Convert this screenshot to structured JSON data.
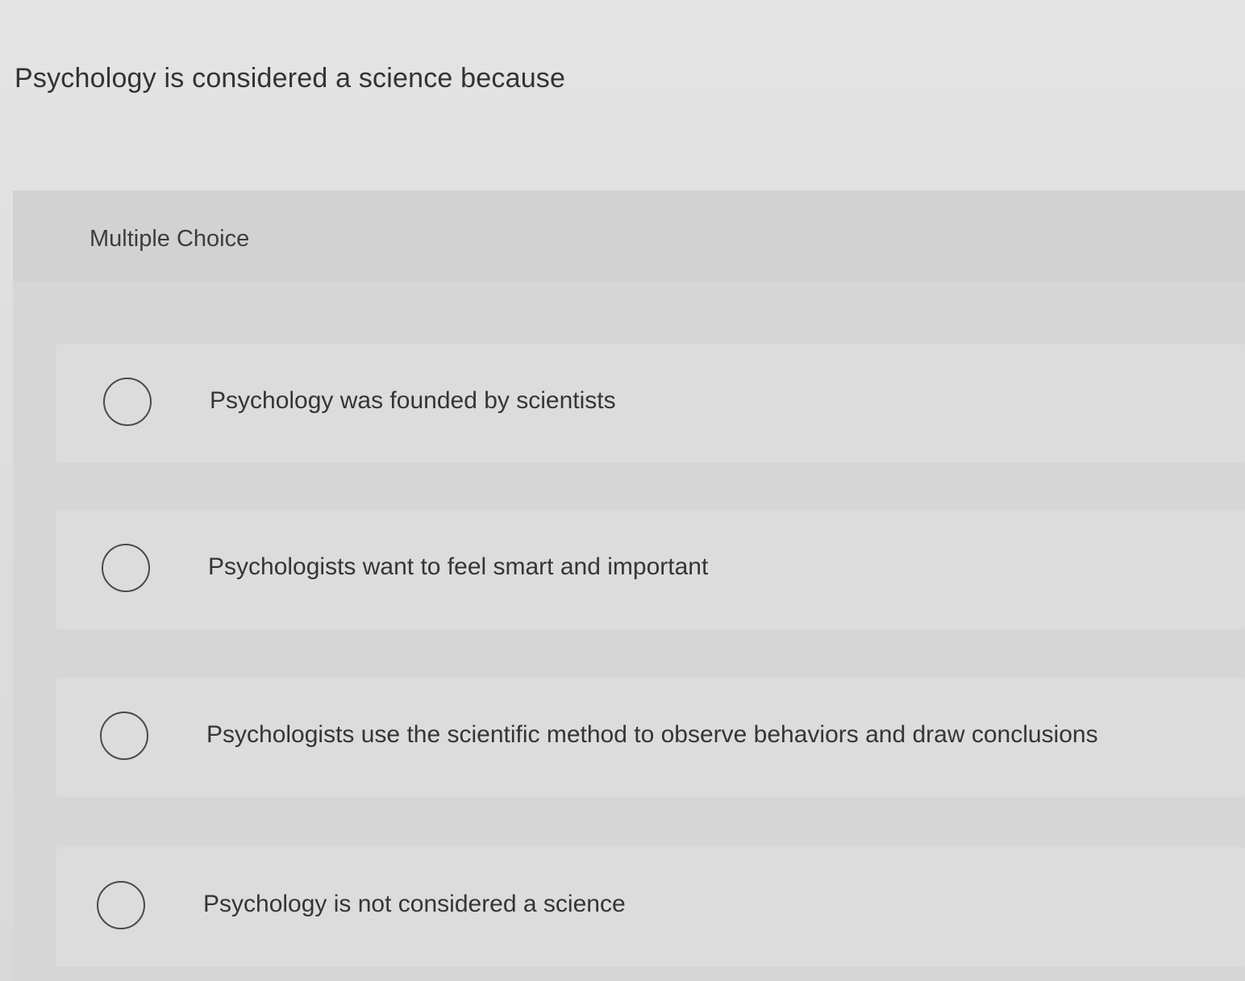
{
  "question": {
    "text": "Psychology is considered a science because"
  },
  "multiple_choice": {
    "label": "Multiple Choice",
    "options": [
      {
        "label": "Psychology was founded by scientists",
        "selected": false
      },
      {
        "label": "Psychologists want to feel smart and important",
        "selected": false
      },
      {
        "label": "Psychologists use the scientific method to observe behaviors and draw conclusions",
        "selected": false
      },
      {
        "label": "Psychology is not considered a science",
        "selected": false
      }
    ]
  }
}
